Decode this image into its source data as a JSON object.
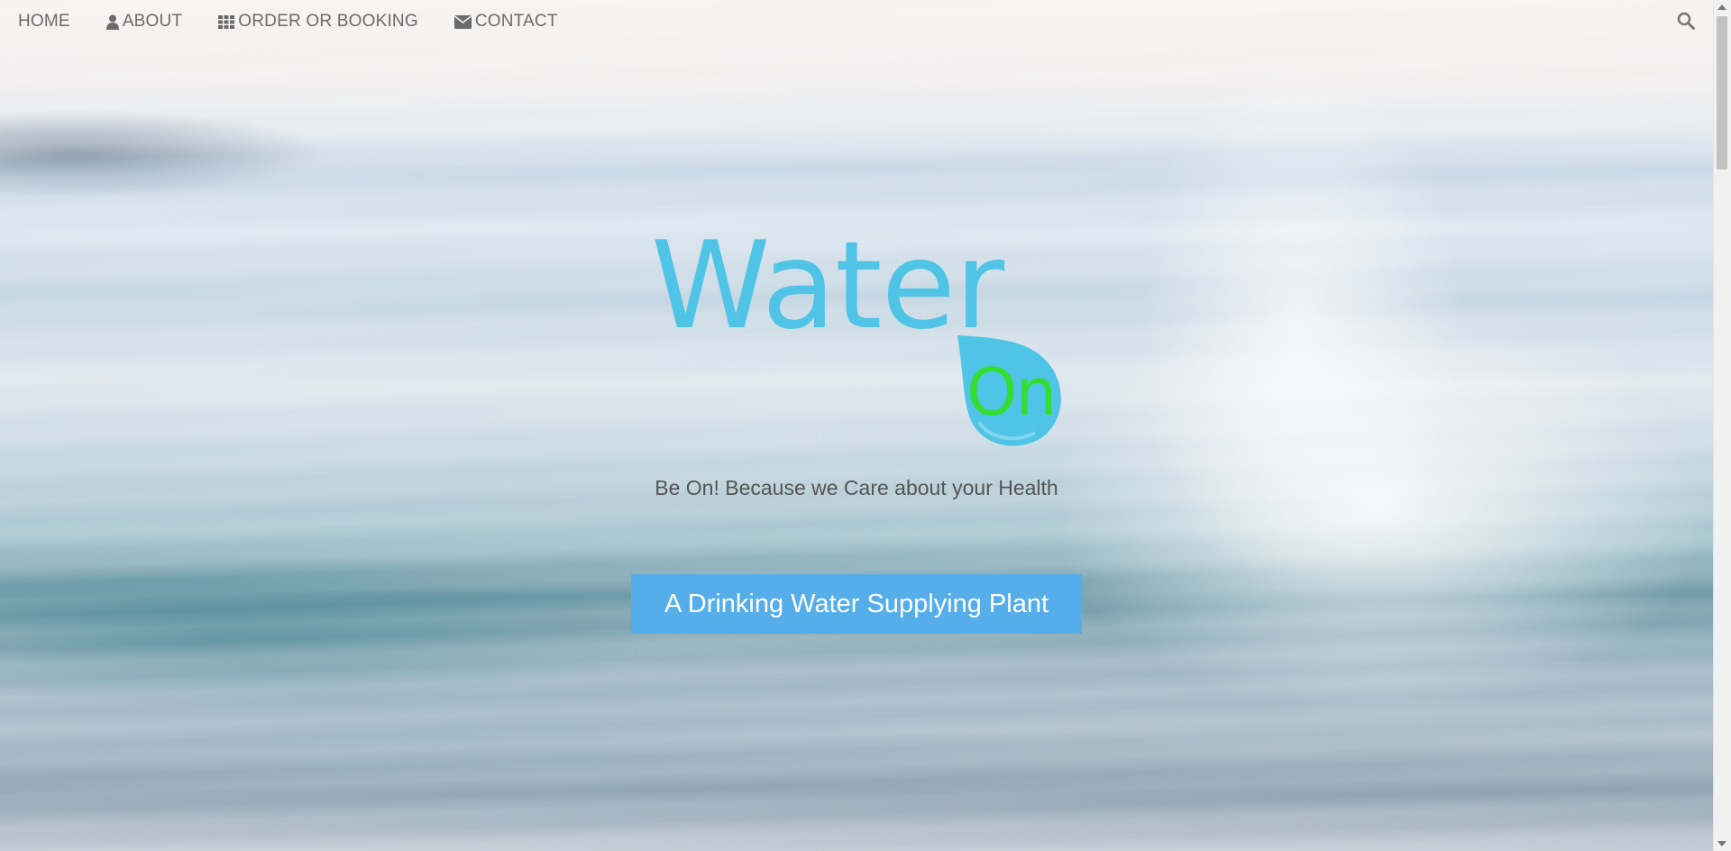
{
  "nav": {
    "items": [
      {
        "label": "HOME",
        "icon": ""
      },
      {
        "label": "ABOUT",
        "icon": "user-icon"
      },
      {
        "label": "ORDER OR BOOKING",
        "icon": "grid-icon"
      },
      {
        "label": "CONTACT",
        "icon": "envelope-icon"
      }
    ],
    "search_icon": "search-icon"
  },
  "hero": {
    "logo_word": "Water",
    "logo_drop_text": "On",
    "tagline": "Be On! Because we Care about your Health",
    "cta_label": "A Drinking Water Supplying Plant"
  },
  "colors": {
    "logo_blue": "#4fc4e6",
    "logo_green": "#33dd33",
    "cta_blue": "#55aeea",
    "nav_text": "#6b6b6b"
  }
}
